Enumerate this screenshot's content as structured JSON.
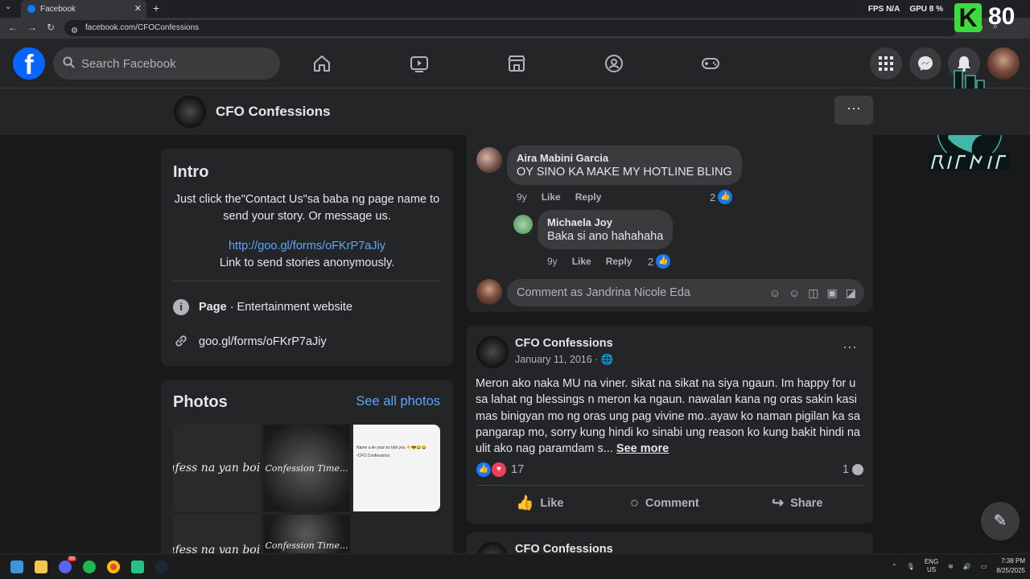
{
  "browser": {
    "tab_title": "Facebook",
    "url": "facebook.com/CFOConfessions",
    "hud_fps_label": "FPS",
    "hud_fps_value": "N/A",
    "hud_gpu_label": "GPU",
    "hud_gpu_value": "8 %"
  },
  "overlay": {
    "k_letter": "K",
    "k_number": "80"
  },
  "header": {
    "search_placeholder": "Search Facebook"
  },
  "page": {
    "title": "CFO Confessions"
  },
  "intro": {
    "heading": "Intro",
    "text": "Just click the\"Contact Us\"sa baba ng page name to send your story. Or message us.",
    "link": "http://goo.gl/forms/oFKrP7aJiy",
    "link_caption": "Link to send stories anonymously.",
    "page_label": "Page",
    "page_category": " · Entertainment website",
    "website": "goo.gl/forms/oFKrP7aJiy"
  },
  "photos": {
    "heading": "Photos",
    "see_all": "See all photos",
    "thumb1": "afess na yan boi!",
    "thumb2": "Confession Time...",
    "thumb3_line1": "Name a lie your ex told you 👇😎😂😂",
    "thumb3_line2": "-CFO Confessions",
    "thumb4": "afess na yan boi!",
    "thumb5": "Confession Time..."
  },
  "comments": [
    {
      "name": "Aira Mabini Garcia",
      "text": "OY SINO KA MAKE MY HOTLINE BLING",
      "age": "9y",
      "like": "Like",
      "reply": "Reply",
      "reactions": "2"
    },
    {
      "name": "Michaela Joy",
      "text": "Baka si ano hahahaha",
      "age": "9y",
      "like": "Like",
      "reply": "Reply",
      "reactions": "2"
    }
  ],
  "comment_box": {
    "placeholder": "Comment as Jandrina Nicole Eda"
  },
  "post": {
    "author": "CFO Confessions",
    "date": "January 11, 2016 · ",
    "body": "Meron ako naka MU na viner. sikat na sikat na siya ngaun. Im happy for u sa lahat ng blessings n meron ka ngaun.  nawalan kana ng oras sakin kasi mas binigyan mo ng oras ung pag vivine mo..ayaw ko naman pigilan ka sa pangarap mo,  sorry kung hindi ko sinabi ung reason ko kung bakit hindi na ulit ako nag paramdam s... ",
    "see_more": "See more",
    "reaction_count": "17",
    "comment_count": "1",
    "like": "Like",
    "comment": "Comment",
    "share": "Share"
  },
  "next_post": {
    "author": "CFO Confessions"
  },
  "taskbar": {
    "lang_line1": "ENG",
    "lang_line2": "US",
    "time": "7:38 PM",
    "date": "8/25/2025",
    "discord_badge": "99"
  }
}
